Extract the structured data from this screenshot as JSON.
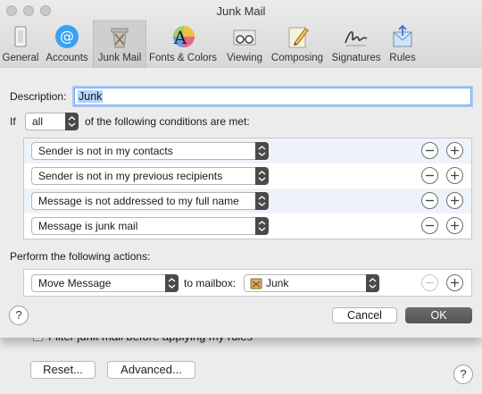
{
  "window": {
    "title": "Junk Mail"
  },
  "toolbar": {
    "items": [
      {
        "label": "General",
        "icon": "switch-icon"
      },
      {
        "label": "Accounts",
        "icon": "at-sign-icon"
      },
      {
        "label": "Junk Mail",
        "icon": "trash-bin-icon"
      },
      {
        "label": "Fonts & Colors",
        "icon": "fonts-colors-icon"
      },
      {
        "label": "Viewing",
        "icon": "glasses-icon"
      },
      {
        "label": "Composing",
        "icon": "pencil-paper-icon"
      },
      {
        "label": "Signatures",
        "icon": "signature-icon"
      },
      {
        "label": "Rules",
        "icon": "rules-icon"
      }
    ],
    "selected": "Junk Mail"
  },
  "sheet": {
    "description_label": "Description:",
    "description_value": "Junk",
    "if_label": "If",
    "if_select": "all",
    "conditions_label": "of the following conditions are met:",
    "conditions": [
      "Sender is not in my contacts",
      "Sender is not in my previous recipients",
      "Message is not addressed to my full name",
      "Message is junk mail"
    ],
    "actions_label": "Perform the following actions:",
    "action": {
      "type": "Move Message",
      "to_label": "to mailbox:",
      "mailbox": "Junk"
    },
    "help": "?",
    "cancel_label": "Cancel",
    "ok_label": "OK"
  },
  "behind": {
    "checkbox_text": "Filter junk mail before applying my rules",
    "reset_label": "Reset...",
    "advanced_label": "Advanced...",
    "help": "?"
  },
  "colors": {
    "selection": "#b4d3fb",
    "focus_ring": "#a9c9f5",
    "ok_button": "#5e5e5e",
    "accounts_icon": "#3aa0f0"
  }
}
